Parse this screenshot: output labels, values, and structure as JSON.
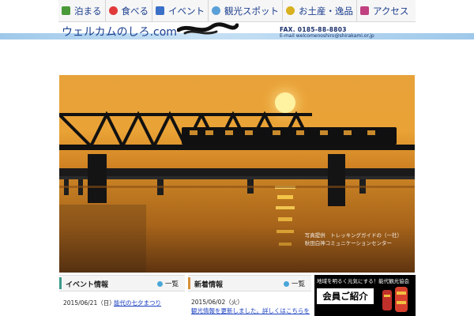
{
  "nav": {
    "items": [
      {
        "label": "泊まる",
        "icon": "hotel-icon"
      },
      {
        "label": "食べる",
        "icon": "food-icon"
      },
      {
        "label": "イベント",
        "icon": "calendar-icon"
      },
      {
        "label": "観光スポット",
        "icon": "camera-icon"
      },
      {
        "label": "お土産・逸品",
        "icon": "gift-icon"
      },
      {
        "label": "アクセス",
        "icon": "train-icon"
      }
    ]
  },
  "header": {
    "site_name": "ウェルカムのしろ.com",
    "fax": "FAX. 0185-88-8803",
    "email": "E-mail   welcomenoshiro@shirakami.or.jp",
    "colors": {
      "wave": "#9ec8ea",
      "text": "#1b3f8f"
    }
  },
  "hero": {
    "caption_line1": "写真提供　トレッキングガイドの（一社）",
    "caption_line2": "秋田白神コミュニケーションセンター"
  },
  "events": {
    "title": "イベント情報",
    "more": "一覧",
    "items": [
      {
        "date": "2015/06/21（日）",
        "text": "能代の七夕まつり"
      }
    ]
  },
  "news": {
    "title": "新着情報",
    "more": "一覧",
    "items": [
      {
        "date": "2015/06/02（火）",
        "text": "観光情報を更新しました。詳しくはこちらをご覧ください"
      }
    ]
  },
  "member_banner": {
    "tagline": "地域を明るく元気にする！能代観光協会",
    "title": "会員ご紹介"
  }
}
